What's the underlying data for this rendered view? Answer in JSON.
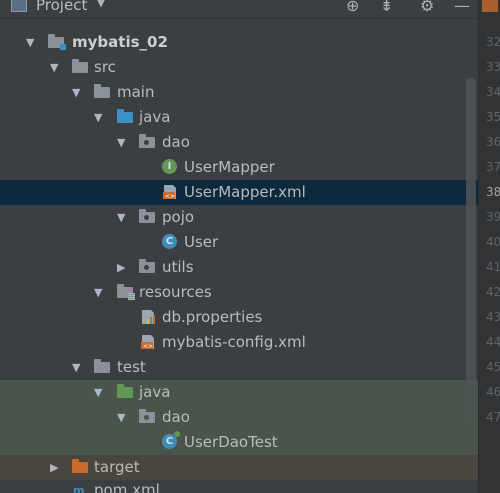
{
  "header": {
    "title": "Project",
    "icons": [
      "target-icon",
      "collapse-icon",
      "gear-icon",
      "minimize-icon"
    ]
  },
  "tree": [
    {
      "label": "",
      "partial": true
    },
    {
      "label": "mybatis_02",
      "type": "module"
    },
    {
      "label": "src",
      "type": "folder"
    },
    {
      "label": "main",
      "type": "folder"
    },
    {
      "label": "java",
      "type": "source-folder"
    },
    {
      "label": "dao",
      "type": "package"
    },
    {
      "label": "UserMapper",
      "type": "interface"
    },
    {
      "label": "UserMapper.xml",
      "type": "xml"
    },
    {
      "label": "pojo",
      "type": "package"
    },
    {
      "label": "User",
      "type": "class"
    },
    {
      "label": "utils",
      "type": "package"
    },
    {
      "label": "resources",
      "type": "resources-folder"
    },
    {
      "label": "db.properties",
      "type": "properties"
    },
    {
      "label": "mybatis-config.xml",
      "type": "xml"
    },
    {
      "label": "test",
      "type": "folder"
    },
    {
      "label": "java",
      "type": "test-source-folder"
    },
    {
      "label": "dao",
      "type": "package"
    },
    {
      "label": "UserDaoTest",
      "type": "test-class"
    },
    {
      "label": "target",
      "type": "excluded-folder"
    },
    {
      "label": "pom.xml",
      "type": "maven"
    }
  ],
  "gutter": {
    "line_numbers": [
      "32",
      "33",
      "34",
      "35",
      "36",
      "37",
      "38",
      "39",
      "40",
      "41",
      "42",
      "43",
      "44",
      "45",
      "46",
      "47"
    ],
    "current_line": "38"
  },
  "colors": {
    "background": "#3c3f41",
    "selected_row": "#0d293e",
    "test_row": "#49544a",
    "excluded_row": "#4a453e"
  }
}
